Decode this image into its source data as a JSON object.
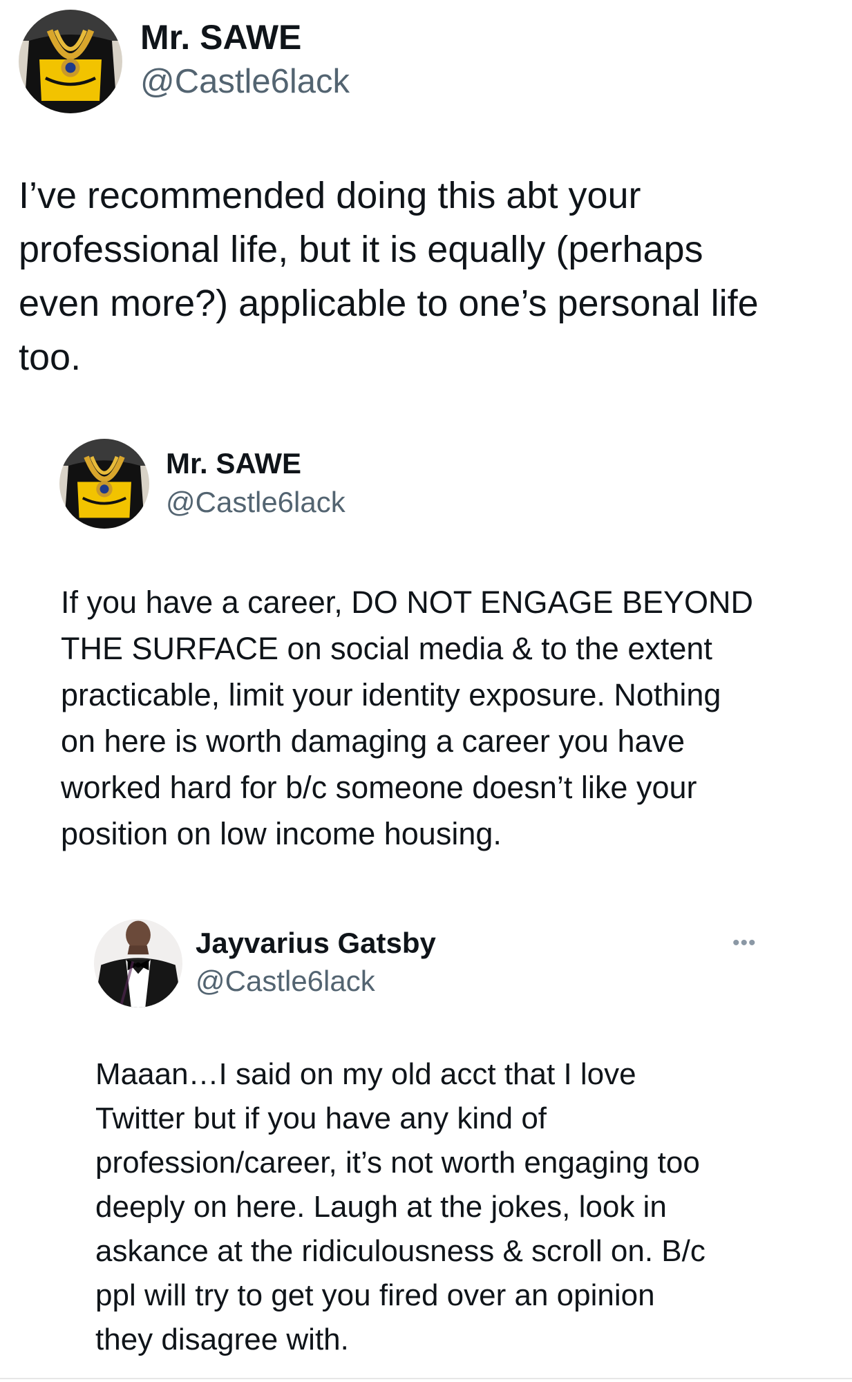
{
  "main_tweet": {
    "name": "Mr. SAWE",
    "handle": "@Castle6lack",
    "text": "I’ve recommended doing this abt your\nprofessional life, but it is equally (perhaps\neven more?) applicable to one’s personal life\ntoo."
  },
  "quoted_tweet": {
    "name": "Mr. SAWE",
    "handle": "@Castle6lack",
    "text": "If you have a career, DO NOT ENGAGE BEYOND\nTHE SURFACE on social media & to the extent\npracticable, limit your identity exposure. Nothing\non here is worth damaging a career you have\nworked hard for b/c someone doesn’t like your\nposition on low income housing."
  },
  "nested_quoted_tweet": {
    "name": "Jayvarius Gatsby",
    "handle": "@Castle6lack",
    "more_label": "•••",
    "text": "Maaan…I said on my old acct that I love\nTwitter but if you have any kind of\nprofession/career, it’s not worth engaging too\ndeeply on here. Laugh at the jokes, look in\naskance at the ridiculousness & scroll on. B/c\nppl will try to get you fired over an opinion\nthey disagree with."
  },
  "avatar_icons": {
    "sawe": "avatar-chain-shirt",
    "gatsby": "avatar-tuxedo"
  },
  "colors": {
    "text": "#0f1419",
    "secondary": "#536471",
    "shirt_yellow": "#f2c300"
  }
}
